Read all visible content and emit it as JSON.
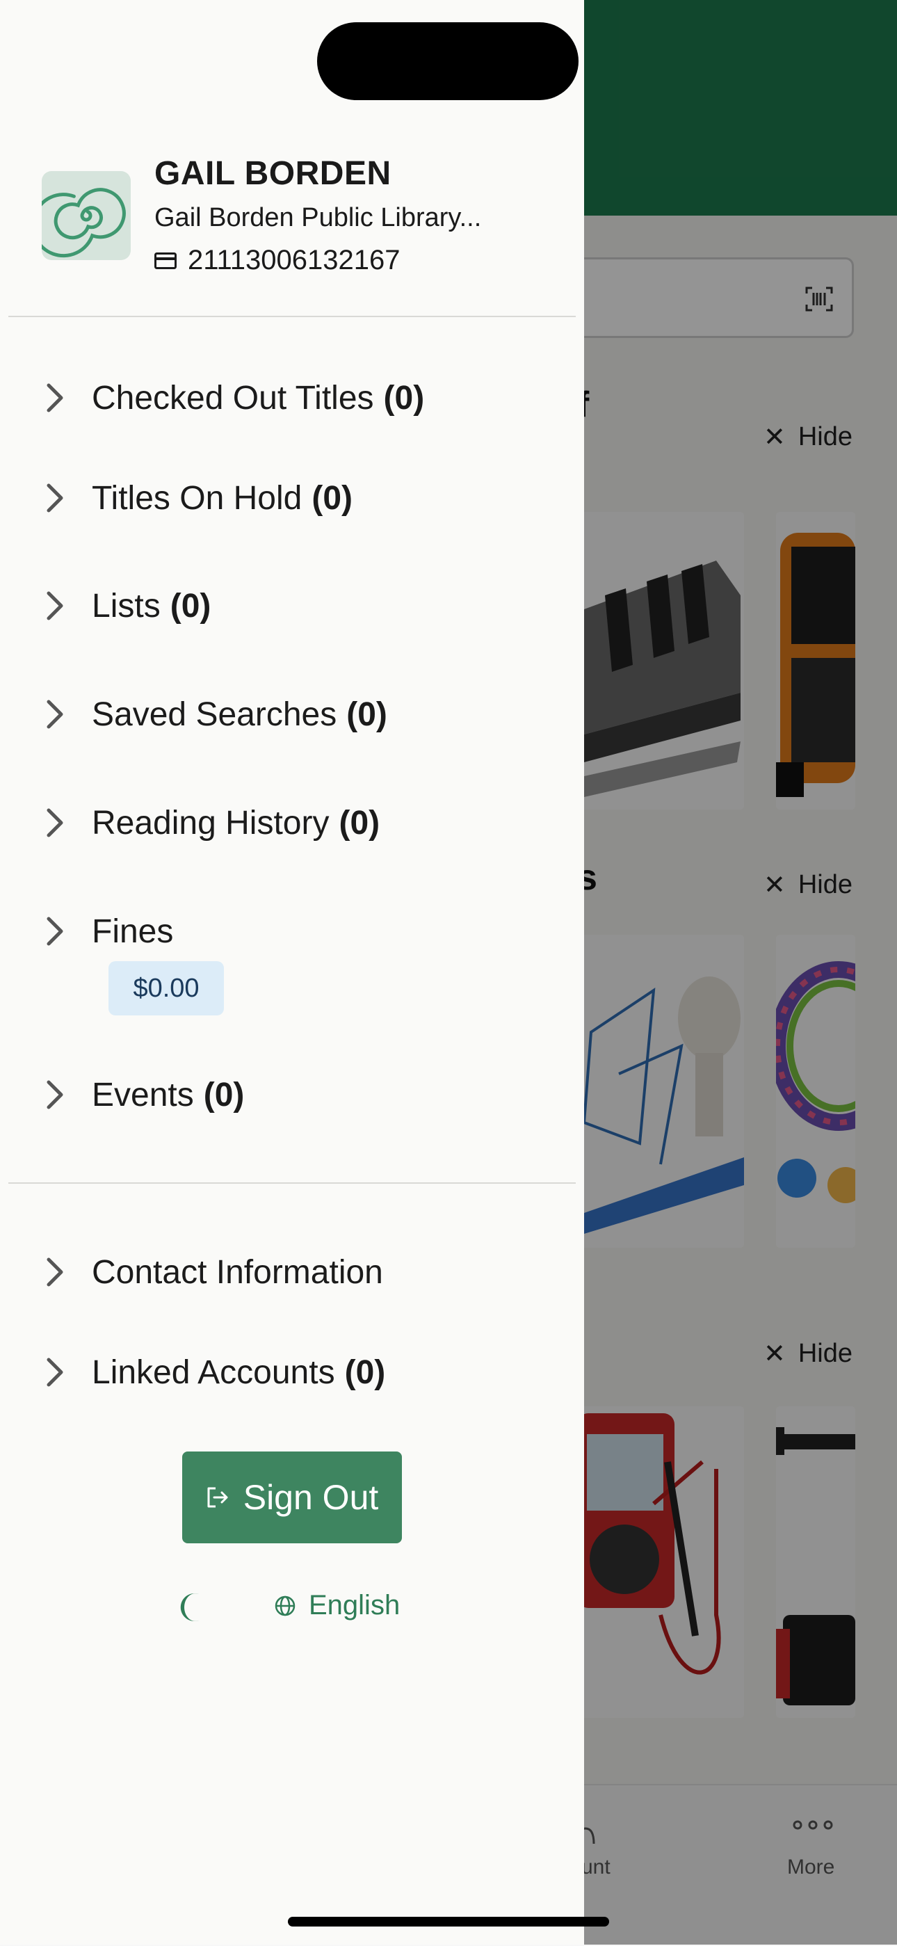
{
  "background": {
    "sections": [
      {
        "title_fragment": "f",
        "hide_label": "Hide"
      },
      {
        "title_fragment": "s",
        "hide_label": "Hide"
      },
      {
        "title_fragment": "",
        "hide_label": "Hide"
      }
    ],
    "tabbar": {
      "account_fragment": "unt",
      "more_label": "More"
    }
  },
  "profile": {
    "name": "GAIL BORDEN",
    "library": "Gail Borden Public Library...",
    "card_number": "21113006132167"
  },
  "menu": {
    "checked_out": {
      "label": "Checked Out Titles",
      "count": "(0)"
    },
    "on_hold": {
      "label": "Titles On Hold",
      "count": "(0)"
    },
    "lists": {
      "label": "Lists",
      "count": "(0)"
    },
    "saved_searches": {
      "label": "Saved Searches",
      "count": "(0)"
    },
    "reading_history": {
      "label": "Reading History",
      "count": "(0)"
    },
    "fines": {
      "label": "Fines",
      "amount": "$0.00"
    },
    "events": {
      "label": "Events",
      "count": "(0)"
    },
    "contact": {
      "label": "Contact Information"
    },
    "linked_accounts": {
      "label": "Linked Accounts",
      "count": "(0)"
    }
  },
  "sign_out_label": "Sign Out",
  "language_label": "English",
  "colors": {
    "brand_green": "#1d7a4e",
    "button_green": "#3e8560",
    "badge_bg": "#dcecf8"
  }
}
